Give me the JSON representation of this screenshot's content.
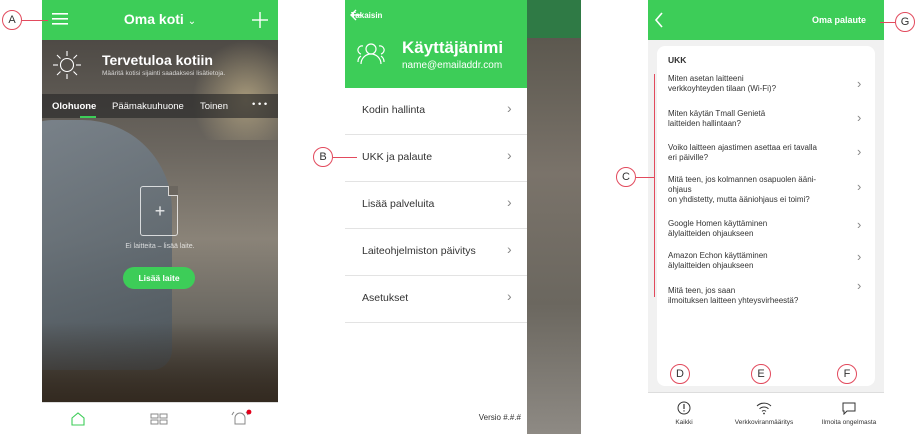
{
  "phone1": {
    "home_title": "Oma koti",
    "welcome_title": "Tervetuloa kotiin",
    "welcome_sub": "Määritä kotisi sijainti saadaksesi lisätietoja.",
    "tabs": [
      "Olohuone",
      "Päämakuuhuone",
      "Toinen"
    ],
    "more": "• • •",
    "empty_text": "Ei laitteita – lisää laite.",
    "add_button": "Lisää laite"
  },
  "phone2": {
    "back": "Takaisin",
    "username": "Käyttäjänimi",
    "email": "name@emailaddr.com",
    "menu": [
      {
        "label": "Kodin hallinta"
      },
      {
        "label": "UKK ja palaute"
      },
      {
        "label": "Lisää palveluita"
      },
      {
        "label": "Laiteohjelmiston päivitys"
      },
      {
        "label": "Asetukset"
      }
    ],
    "version": "Versio #.#.#"
  },
  "phone3": {
    "title": "Oma palaute",
    "section": "UKK",
    "questions": [
      {
        "line1": "Miten asetan laitteeni",
        "line2": "verkkoyhteyden tilaan (Wi-Fi)?",
        "line3": ""
      },
      {
        "line1": "Miten käytän Tmall Genietä",
        "line2": "laitteiden hallintaan?",
        "line3": ""
      },
      {
        "line1": "Voiko laitteen ajastimen asettaa eri tavalla",
        "line2": "eri päiville?",
        "line3": ""
      },
      {
        "line1": "Mitä teen, jos kolmannen osapuolen ääni-",
        "line2": "ohjaus",
        "line3": "on yhdistetty, mutta ääniohjaus ei toimi?"
      },
      {
        "line1": "Google Homen käyttäminen",
        "line2": "älylaitteiden ohjaukseen",
        "line3": ""
      },
      {
        "line1": "Amazon Echon käyttäminen",
        "line2": "älylaitteiden ohjaukseen",
        "line3": ""
      },
      {
        "line1": "Mitä teen, jos saan",
        "line2": "ilmoituksen laitteen yhteysvirheestä?",
        "line3": ""
      }
    ],
    "bottom": [
      "Kaikki",
      "Verkkoviranmääritys",
      "Ilmoita ongelmasta"
    ]
  },
  "callouts": {
    "A": "A",
    "B": "B",
    "C": "C",
    "D": "D",
    "E": "E",
    "F": "F",
    "G": "G"
  },
  "colors": {
    "brand_green": "#3dcd58",
    "annotation_red": "#e24a5d",
    "notification_dot": "#e3001b"
  }
}
